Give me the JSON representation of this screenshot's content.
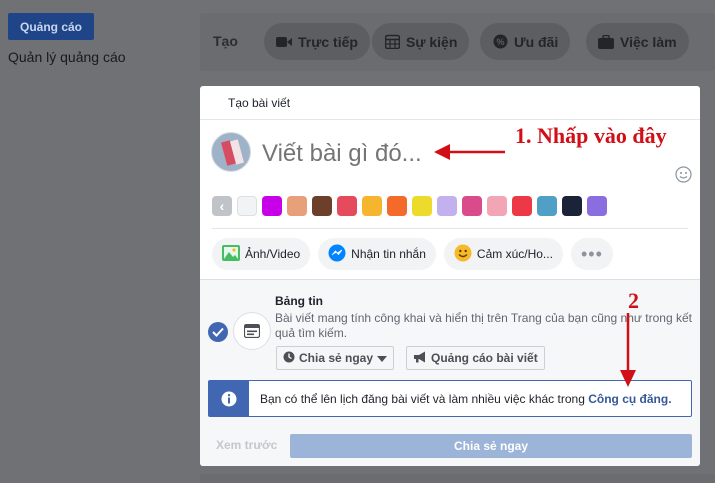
{
  "sidebar": {
    "ads_button": "Quảng cáo",
    "ads_manager_link": "Quản lý quảng cáo"
  },
  "create_bar": {
    "label": "Tạo",
    "actions": [
      {
        "label": "Trực tiếp",
        "icon": "video-camera-icon"
      },
      {
        "label": "Sự kiện",
        "icon": "calendar-icon"
      },
      {
        "label": "Ưu đãi",
        "icon": "offer-badge-icon"
      },
      {
        "label": "Việc làm",
        "icon": "briefcase-icon"
      }
    ]
  },
  "composer": {
    "title": "Tạo bài viết",
    "placeholder": "Viết bài gì đó...",
    "background_swatches": [
      "#f2f3f5",
      "#c800e8",
      "#e8a07a",
      "#6b3f2a",
      "#e54b5d",
      "#f5b52e",
      "#f36a2a",
      "#ecdb2a",
      "#c3b1ef",
      "#d94b8a",
      "#f2a5b5",
      "#ec3847",
      "#4f9fc6",
      "#1b2338",
      "#8a6ee0"
    ],
    "actions": [
      {
        "label": "Ảnh/Video",
        "icon": "photo-icon"
      },
      {
        "label": "Nhận tin nhắn",
        "icon": "messenger-icon"
      },
      {
        "label": "Cảm xúc/Ho...",
        "icon": "smiley-icon"
      }
    ]
  },
  "audience": {
    "title": "Bảng tin",
    "description": "Bài viết mang tính công khai và hiển thị trên Trang của bạn cũng như trong kết quả tìm kiếm.",
    "share_now_dropdown": "Chia sẻ ngay",
    "boost_button": "Quảng cáo bài viết"
  },
  "info": {
    "text": "Bạn có thể lên lịch đăng bài viết và làm nhiều việc khác trong ",
    "link": "Công cụ đăng."
  },
  "footer": {
    "preview_button": "Xem trước",
    "share_button": "Chia sẻ ngay"
  },
  "annotations": {
    "step1": "1. Nhấp vào đây",
    "step2": "2"
  },
  "colors": {
    "brand_blue": "#4267b2",
    "annotation_red": "#d10f16"
  }
}
